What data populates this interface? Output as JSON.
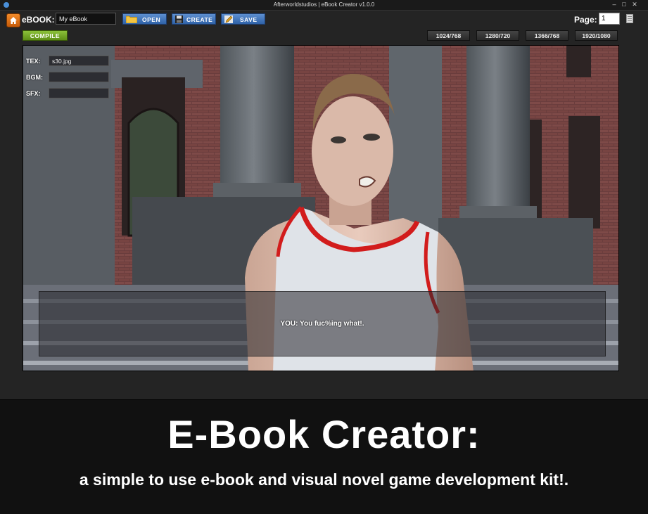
{
  "window": {
    "title": "Afterworldstudios | eBook Creator v1.0.0"
  },
  "toolbar": {
    "ebook_label": "eBOOK:",
    "ebook_name": "My eBook",
    "open_label": "OPEN",
    "create_label": "CREATE",
    "save_label": "SAVE",
    "page_label": "Page:",
    "page_value": "1"
  },
  "compile_label": "COMPILE",
  "resolutions": [
    "1024/768",
    "1280/720",
    "1366/768",
    "1920/1080"
  ],
  "fields": {
    "tex_label": "TEX:",
    "tex_value": "s30.jpg",
    "bgm_label": "BGM:",
    "bgm_value": "",
    "sfx_label": "SFX:",
    "sfx_value": ""
  },
  "dialogue": "YOU: You fuc%ing what!.",
  "promo": {
    "title": "E-Book Creator:",
    "subtitle": "a simple to use e-book and visual novel game development kit!."
  },
  "colors": {
    "tool_button": "#3f74bd",
    "compile_button": "#78ad2a",
    "home_button": "#e0761a"
  }
}
